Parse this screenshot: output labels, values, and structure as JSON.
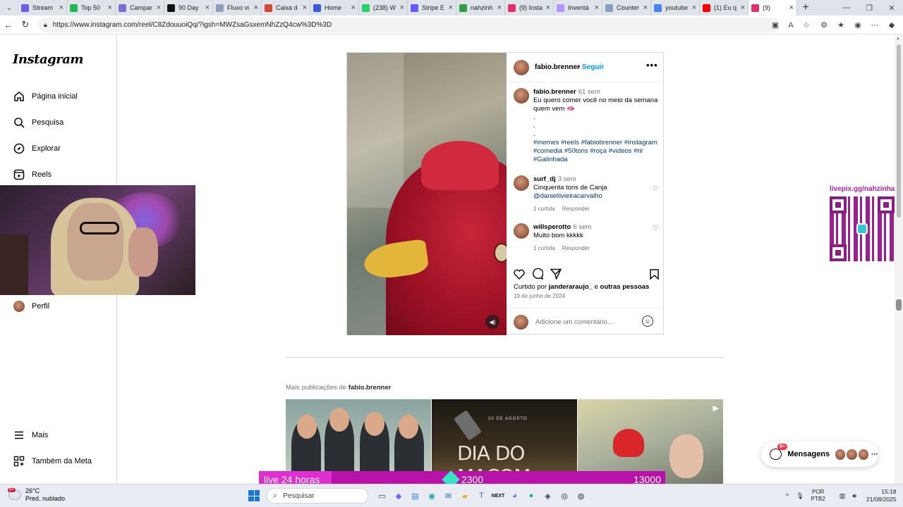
{
  "browser": {
    "tabs": [
      {
        "label": "Stream",
        "color": "#6c5ce7"
      },
      {
        "label": "Top 50",
        "color": "#1db954"
      },
      {
        "label": "Campar",
        "color": "#7b6fd6"
      },
      {
        "label": "90 Day",
        "color": "#111111"
      },
      {
        "label": "Fluxo vi",
        "color": "#8aa0b8"
      },
      {
        "label": "Caixa d",
        "color": "#d44638"
      },
      {
        "label": "Home",
        "color": "#3b5bdb"
      },
      {
        "label": "(238) W",
        "color": "#25d366"
      },
      {
        "label": "Stripe E",
        "color": "#635bff"
      },
      {
        "label": "nahzinh",
        "color": "#2f9e44"
      },
      {
        "label": "(9) Insta",
        "color": "#e1306c"
      },
      {
        "label": "Inventá",
        "color": "#b197fc"
      },
      {
        "label": "Counter",
        "color": "#8aa0b8"
      },
      {
        "label": "youtube",
        "color": "#4285f4"
      },
      {
        "label": "(1) Eu q",
        "color": "#ff0000"
      },
      {
        "label": "(9)",
        "color": "#e1306c"
      }
    ],
    "url": "https://www.instagram.com/reel/C8ZdouuoiQq/?igsh=MWZsaGsxemNhZzQ4cw%3D%3D"
  },
  "sidebar": {
    "logo": "Instagram",
    "items": [
      {
        "label": "Página inicial",
        "icon": "home-icon"
      },
      {
        "label": "Pesquisa",
        "icon": "search-icon"
      },
      {
        "label": "Explorar",
        "icon": "compass-icon"
      },
      {
        "label": "Reels",
        "icon": "reels-icon"
      },
      {
        "label": "Perfil",
        "icon": "avatar"
      },
      {
        "label": "Mais",
        "icon": "menu-icon"
      },
      {
        "label": "Também da Meta",
        "icon": "meta-icon"
      }
    ]
  },
  "post": {
    "username": "fabio.brenner",
    "dot": "•",
    "follow": "Seguir",
    "caption": {
      "username": "fabio.brenner",
      "time": "61 sem",
      "text": "Eu quero comer você no meio da semana quem vem 🫦",
      "dots": ".\n.\n.",
      "hashtags": " #memes #reels #fabiobrenner #instagram #comedia #50tons  #roça #videos #rir #Galinhada"
    },
    "comments": [
      {
        "username": "surf_dj",
        "time": "3 sem",
        "text": "Cinquenta tons de Canja",
        "mention": "@daniellivieiracarvalho",
        "likes": "1 curtida",
        "reply": "Responder"
      },
      {
        "username": "willsperotto",
        "time": "6 sem",
        "text": "Muito bom kkkkk",
        "likes": "1 curtida",
        "reply": "Responder"
      }
    ],
    "liked_prefix": "Curtido por",
    "liked_user": "janderaraujo_",
    "liked_and": "e",
    "liked_others": "outras pessoas",
    "date": "19 de junho de 2024",
    "comment_placeholder": "Adicione um comentário..."
  },
  "more_posts": {
    "prefix": "Mais publicações de",
    "user": "fabio.brenner"
  },
  "thumb2": {
    "small": "20 DE AGOSTO",
    "big": "DIA DO MAÇOM"
  },
  "overlay": {
    "qr_label": "livepix.gg/nahzinhaa",
    "live_label": "live 24 horas",
    "live_value1": "2300",
    "live_value2": "13000"
  },
  "messages": {
    "label": "Mensagens",
    "badge": "9+"
  },
  "taskbar": {
    "temp": "26°C",
    "weather": "Pred. nublado",
    "weather_badge": "9+",
    "search": "Pesquisar",
    "lang1": "POR",
    "lang2": "PTB2",
    "time": "15:18",
    "date": "21/08/2025"
  },
  "colors": {
    "accent": "#0095f6",
    "live_bg": "#b812a9",
    "live_label_bg": "#e02fd0"
  }
}
